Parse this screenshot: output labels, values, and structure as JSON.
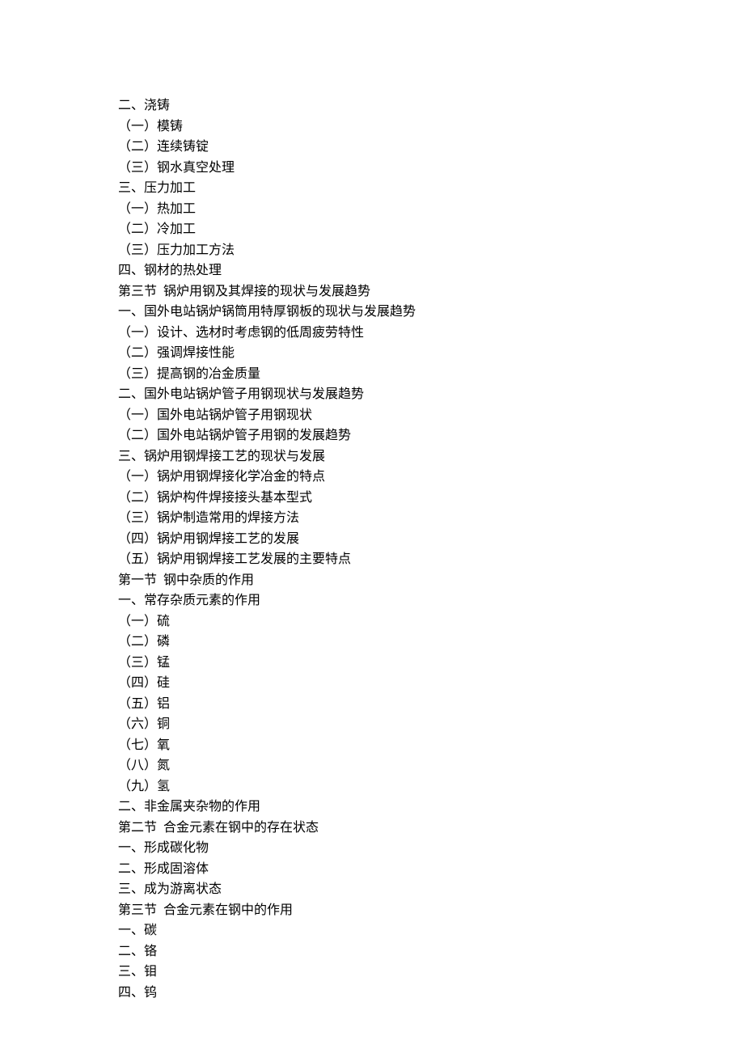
{
  "lines": [
    "二、浇铸",
    "（一）模铸",
    "（二）连续铸锭",
    "（三）钢水真空处理",
    "三、压力加工",
    "（一）热加工",
    "（二）冷加工",
    "（三）压力加工方法",
    "四、钢材的热处理",
    "第三节  锅炉用钢及其焊接的现状与发展趋势",
    "一、国外电站锅炉锅筒用特厚钢板的现状与发展趋势",
    "（一）设计、选材时考虑钢的低周疲劳特性",
    "（二）强调焊接性能",
    "（三）提高钢的冶金质量",
    "二、国外电站锅炉管子用钢现状与发展趋势",
    "（一）国外电站锅炉管子用钢现状",
    "（二）国外电站锅炉管子用钢的发展趋势",
    "三、锅炉用钢焊接工艺的现状与发展",
    "（一）锅炉用钢焊接化学冶金的特点",
    "（二）锅炉构件焊接接头基本型式",
    "（三）锅炉制造常用的焊接方法",
    "（四）锅炉用钢焊接工艺的发展",
    "（五）锅炉用钢焊接工艺发展的主要特点",
    "第一节  钢中杂质的作用",
    "一、常存杂质元素的作用",
    "（一）硫",
    "（二）磷",
    "（三）锰",
    "（四）硅",
    "（五）铝",
    "（六）铜",
    "（七）氧",
    "（八）氮",
    "（九）氢",
    "二、非金属夹杂物的作用",
    "第二节  合金元素在钢中的存在状态",
    "一、形成碳化物",
    "二、形成固溶体",
    "三、成为游离状态",
    "第三节  合金元素在钢中的作用",
    "一、碳",
    "二、铬",
    "三、钼",
    "四、钨"
  ]
}
